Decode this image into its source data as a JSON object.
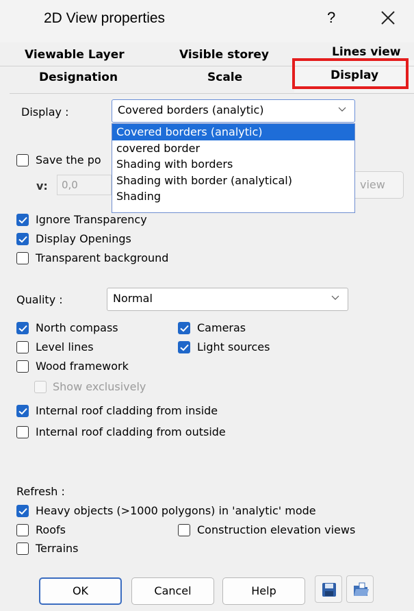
{
  "window": {
    "title": "2D View properties",
    "help_label": "?",
    "close_icon": "close-icon"
  },
  "tabs": {
    "row1": [
      "Viewable Layer",
      "Visible storey",
      "Lines view"
    ],
    "row2": [
      "Designation",
      "Scale",
      "Display"
    ],
    "active": "Display",
    "highlight_color": "#e41d1d"
  },
  "display_section": {
    "label": "Display :",
    "selected": "Covered borders (analytic)",
    "options": [
      "Covered borders (analytic)",
      "covered border",
      "Shading with borders",
      "Shading with border (analytical)",
      "Shading"
    ]
  },
  "save_position": {
    "label_visible": "Save the po",
    "checked": false,
    "v_label": "v:",
    "v_value": "0,0",
    "view_button_partial": "view"
  },
  "options_group1": [
    {
      "label": "Ignore Transparency",
      "checked": true
    },
    {
      "label": "Display Openings",
      "checked": true
    },
    {
      "label": "Transparent background",
      "checked": false
    }
  ],
  "quality": {
    "label": "Quality :",
    "value": "Normal"
  },
  "options_group2": {
    "left": [
      {
        "label": "North compass",
        "checked": true
      },
      {
        "label": "Level lines",
        "checked": false
      },
      {
        "label": "Wood framework",
        "checked": false
      }
    ],
    "right": [
      {
        "label": "Cameras",
        "checked": true
      },
      {
        "label": "Light sources",
        "checked": true
      }
    ],
    "show_exclusively": {
      "label": "Show exclusively",
      "checked": false,
      "disabled": true
    },
    "roof_inside": {
      "label": "Internal roof cladding from inside",
      "checked": true
    },
    "roof_outside": {
      "label": "Internal roof cladding from outside",
      "checked": false
    }
  },
  "refresh": {
    "label": "Refresh :",
    "heavy": {
      "label": "Heavy objects (>1000 polygons) in 'analytic' mode",
      "checked": true
    },
    "roofs": {
      "label": "Roofs",
      "checked": false
    },
    "construction": {
      "label": "Construction elevation views",
      "checked": false
    },
    "terrains": {
      "label": "Terrains",
      "checked": false
    }
  },
  "buttons": {
    "ok": "OK",
    "cancel": "Cancel",
    "help": "Help",
    "save_icon": "save-icon",
    "open_icon": "open-folder-icon"
  },
  "colors": {
    "accent": "#1f67c9",
    "selection": "#1e6dd8"
  }
}
